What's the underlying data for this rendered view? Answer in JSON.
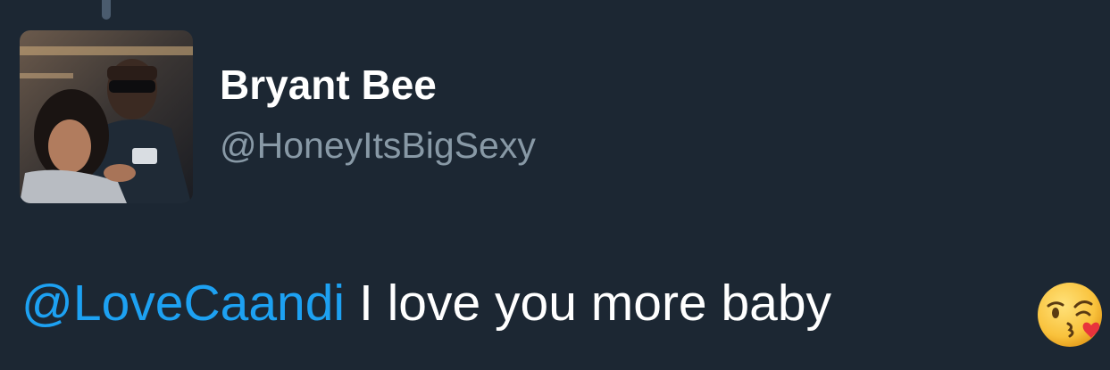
{
  "tweet": {
    "author_name": "Bryant Bee",
    "author_handle": "@HoneyItsBigSexy",
    "mention": "@LoveCaandi",
    "body": " I love you more baby",
    "emoji_name": "face-blowing-a-kiss-emoji"
  },
  "colors": {
    "background": "#1c2733",
    "mention": "#1da1f2",
    "handle": "#8899a6",
    "text": "#ffffff"
  }
}
